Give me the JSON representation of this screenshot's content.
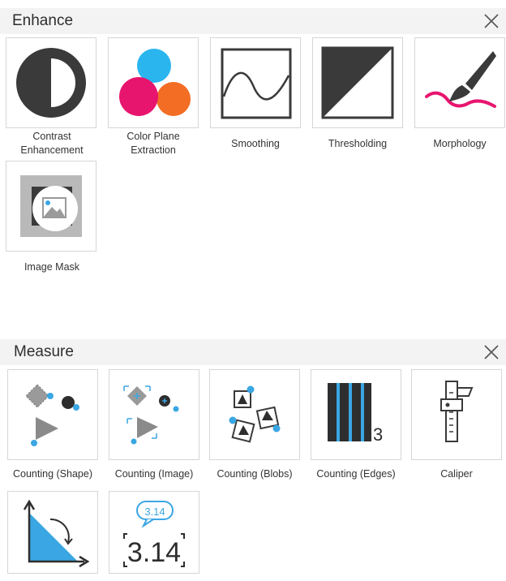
{
  "enhance": {
    "title": "Enhance",
    "tools": [
      {
        "label": "Contrast\nEnhancement",
        "icon": "contrast-icon"
      },
      {
        "label": "Color Plane\nExtraction",
        "icon": "color-plane-icon"
      },
      {
        "label": "Smoothing",
        "icon": "smoothing-icon"
      },
      {
        "label": "Thresholding",
        "icon": "thresholding-icon"
      },
      {
        "label": "Morphology",
        "icon": "paintbrush-icon"
      },
      {
        "label": "Image Mask",
        "icon": "image-mask-icon"
      }
    ]
  },
  "measure": {
    "title": "Measure",
    "tools": [
      {
        "label": "Counting (Shape)",
        "icon": "counting-shape-icon"
      },
      {
        "label": "Counting (Image)",
        "icon": "counting-image-icon"
      },
      {
        "label": "Counting (Blobs)",
        "icon": "counting-blobs-icon"
      },
      {
        "label": "Counting (Edges)",
        "icon": "counting-edges-icon",
        "icon_text": "3"
      },
      {
        "label": "Caliper",
        "icon": "caliper-icon"
      },
      {
        "label": "",
        "icon": "angle-icon"
      },
      {
        "label": "",
        "icon": "numeric-readout-icon",
        "bubble_text": "3.14",
        "readout_text": "3.14"
      }
    ]
  },
  "colors": {
    "header_bg": "#f3f3f3",
    "dark": "#3a3a3a",
    "accent_blue": "#3aa6e3",
    "pink": "#e8156f",
    "orange": "#f36d24",
    "cyan": "#2bb5ef"
  }
}
